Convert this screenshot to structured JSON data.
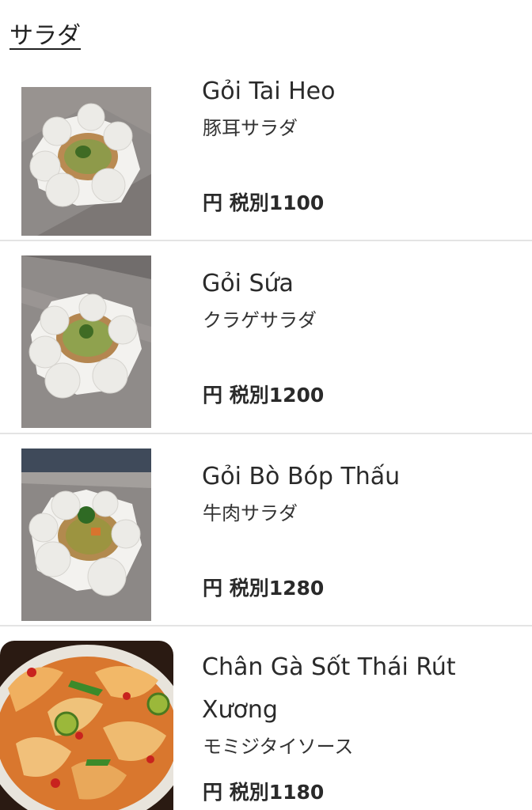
{
  "section": {
    "title": "サラダ"
  },
  "items": [
    {
      "name": "Gỏi Tai Heo",
      "jp": "豚耳サラダ",
      "price": "円 税別1100"
    },
    {
      "name": "Gỏi Sứa",
      "jp": "クラゲサラダ",
      "price": "円 税別1200"
    },
    {
      "name": "Gỏi Bò Bóp Thấu",
      "jp": "牛肉サラダ",
      "price": "円 税別1280"
    },
    {
      "name_line1": "Chân Gà Sốt Thái Rút",
      "name_line2": "Xương",
      "jp": "モミジタイソース",
      "price": "円 税別1180"
    }
  ]
}
